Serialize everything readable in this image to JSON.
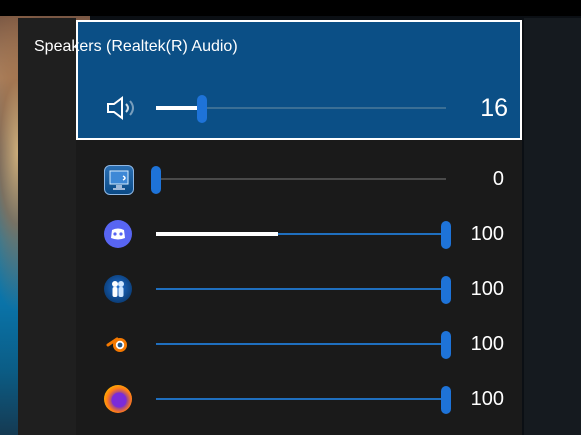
{
  "device": {
    "title": "Speakers (Realtek(R) Audio)",
    "volume": 16
  },
  "apps": [
    {
      "name": "System Sounds",
      "icon": "system-sounds-icon",
      "volume": 0,
      "display": "0",
      "muted_track": true
    },
    {
      "name": "Discord",
      "icon": "discord-icon",
      "volume": 100,
      "display": "100",
      "progress_white": 0.42
    },
    {
      "name": "Voice Meeting App",
      "icon": "two-people-icon",
      "volume": 100,
      "display": "100"
    },
    {
      "name": "Blender",
      "icon": "blender-icon",
      "volume": 100,
      "display": "100"
    },
    {
      "name": "Firefox",
      "icon": "firefox-icon",
      "volume": 100,
      "display": "100"
    }
  ],
  "colors": {
    "device_bg": "#0b4f86",
    "accent": "#1e73d8",
    "list_bg": "#1a1a1a"
  }
}
